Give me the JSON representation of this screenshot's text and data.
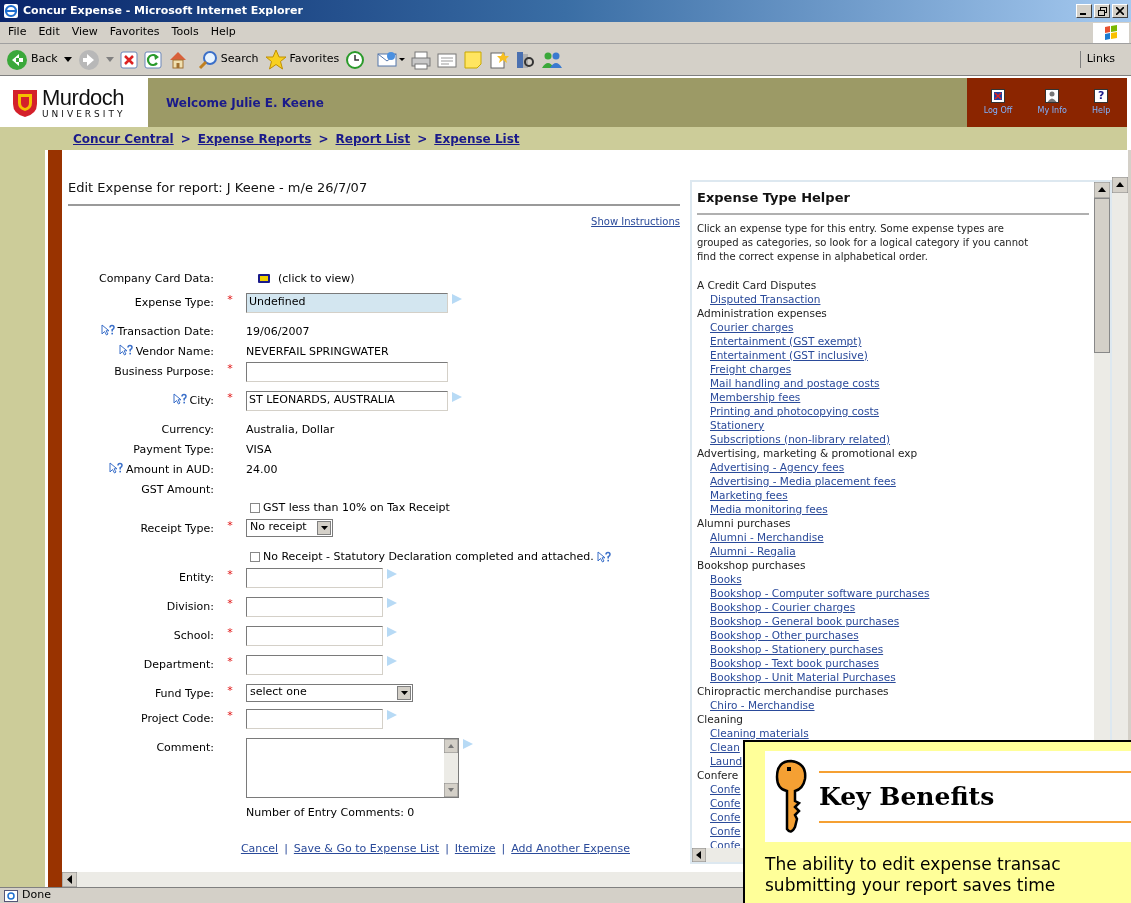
{
  "window": {
    "title": "Concur Expense - Microsoft Internet Explorer"
  },
  "menu": [
    "File",
    "Edit",
    "View",
    "Favorites",
    "Tools",
    "Help"
  ],
  "toolbar": {
    "back": "Back",
    "search": "Search",
    "favorites": "Favorites",
    "links": "Links"
  },
  "header": {
    "logo_name": "Murdoch",
    "logo_sub": "UNIVERSITY",
    "welcome": "Welcome Julie E. Keene",
    "actions": [
      {
        "kind": "logoff",
        "label": "Log Off"
      },
      {
        "kind": "info",
        "label": "My Info"
      },
      {
        "kind": "help",
        "label": "Help",
        "glyph": "?"
      }
    ]
  },
  "breadcrumb": [
    {
      "label": "Concur Central"
    },
    {
      "sep": ">",
      "label": "Expense Reports"
    },
    {
      "sep": ">",
      "label": "Report List"
    },
    {
      "sep": ">",
      "label": "Expense List"
    }
  ],
  "form": {
    "title": "Edit Expense for report: J Keene - m/e 26/7/07",
    "instructions_link": "Show Instructions",
    "fields": [
      {
        "kind": "card",
        "label": "Company Card Data:",
        "value": "(click to view)"
      },
      {
        "kind": "wide_field",
        "label": "Expense Type:",
        "required_mark": "*",
        "value": "Undefined",
        "highlighted": true,
        "lookup": true
      },
      {
        "kind": "static",
        "label": "Transaction Date:",
        "help": true,
        "value": "19/06/2007"
      },
      {
        "kind": "static",
        "label": "Vendor Name:",
        "help": true,
        "value": "NEVERFAIL SPRINGWATER"
      },
      {
        "kind": "wide_field",
        "label": "Business Purpose:",
        "required_mark": "*"
      },
      {
        "kind": "wide_field",
        "label": "City:",
        "required_mark": "*",
        "help": true,
        "value": "ST LEONARDS, AUSTRALIA",
        "lookup": true
      },
      {
        "kind": "static",
        "label": "Currency:",
        "value": "Australia, Dollar"
      },
      {
        "kind": "static",
        "label": "Payment Type:",
        "value": "VISA"
      },
      {
        "kind": "static",
        "label": "Amount in AUD:",
        "help": true,
        "value": "24.00"
      },
      {
        "kind": "static",
        "label": "GST Amount:"
      },
      {
        "kind": "checkbox",
        "text": "GST less than 10% on Tax Receipt",
        "checked": false
      },
      {
        "kind": "short_select",
        "label": "Receipt Type:",
        "required_mark": "*",
        "value": "No receipt"
      },
      {
        "kind": "checkbox",
        "text": "No Receipt - Statutory Declaration completed and attached.",
        "checked": false,
        "help": true
      },
      {
        "kind": "code_field",
        "label": "Entity:",
        "required_mark": "*",
        "lookup": true
      },
      {
        "kind": "code_field",
        "label": "Division:",
        "required_mark": "*",
        "lookup": true
      },
      {
        "kind": "code_field",
        "label": "School:",
        "required_mark": "*",
        "lookup": true
      },
      {
        "kind": "code_field",
        "label": "Department:",
        "required_mark": "*",
        "lookup": true
      },
      {
        "kind": "long_select",
        "label": "Fund Type:",
        "required_mark": "*",
        "value": "select one"
      },
      {
        "kind": "code_field",
        "label": "Project Code:",
        "required_mark": "*",
        "lookup": true
      },
      {
        "kind": "textarea",
        "label": "Comment:",
        "lookup": true
      }
    ],
    "comment_count": "Number of Entry Comments: 0",
    "actions": [
      {
        "label": "Cancel"
      },
      {
        "sep": "|",
        "label": "Save & Go to Expense List"
      },
      {
        "sep": "|",
        "label": "Itemize"
      },
      {
        "sep": "|",
        "label": "Add Another Expense"
      }
    ]
  },
  "helper": {
    "title": "Expense Type Helper",
    "intro": "Click an expense type for this entry. Some expense types are grouped as categories, so look for a logical category if you cannot find the correct expense in alphabetical order.",
    "groups": [
      {
        "name": "A Credit Card Disputes",
        "items": [
          "Disputed Transaction"
        ]
      },
      {
        "name": "Administration expenses",
        "items": [
          "Courier charges",
          "Entertainment (GST exempt)",
          "Entertainment (GST inclusive)",
          "Freight charges",
          "Mail handling and postage costs",
          "Membership fees",
          "Printing and photocopying costs",
          "Stationery",
          "Subscriptions (non-library related)"
        ]
      },
      {
        "name": "Advertising, marketing & promotional exp",
        "items": [
          "Advertising - Agency fees",
          "Advertising - Media placement fees",
          "Marketing fees",
          "Media monitoring fees"
        ]
      },
      {
        "name": "Alumni purchases",
        "items": [
          "Alumni - Merchandise",
          "Alumni - Regalia"
        ]
      },
      {
        "name": "Bookshop purchases",
        "items": [
          "Books",
          "Bookshop - Computer software purchases",
          "Bookshop - Courier charges",
          "Bookshop - General book purchases",
          "Bookshop - Other purchases",
          "Bookshop - Stationery purchases",
          "Bookshop - Text book purchases",
          "Bookshop - Unit Material Purchases"
        ]
      },
      {
        "name": "Chiropractic merchandise purchases",
        "items": [
          "Chiro - Merchandise"
        ]
      },
      {
        "name": "Cleaning",
        "items": [
          "Cleaning materials",
          "Clean",
          "Laund"
        ]
      },
      {
        "name": "Confere",
        "items": [
          "Confe",
          "Confe",
          "Confe",
          "Confe",
          "Confe"
        ]
      }
    ]
  },
  "callout": {
    "title": "Key Benefits",
    "text": "The ability to edit expense transac",
    "text_2": "submitting your report saves time"
  },
  "status_bar": {
    "text": "Done"
  }
}
